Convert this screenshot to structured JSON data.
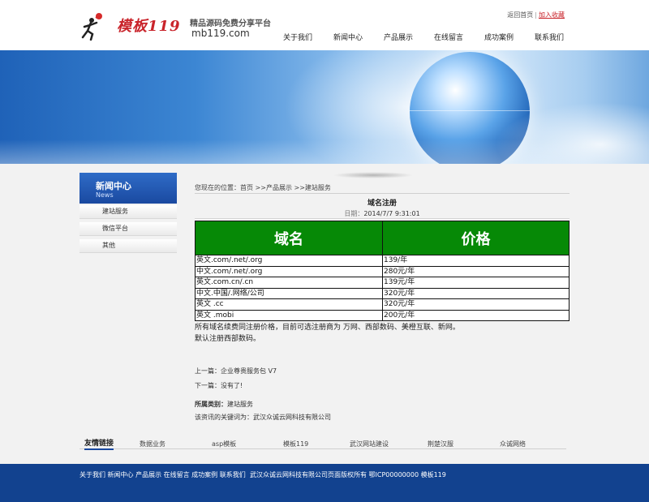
{
  "header": {
    "brand": "模板119",
    "slogan": "精品源码免费分享平台",
    "site": "mb119.com",
    "top_links": {
      "home": "返回首页",
      "separator": "|",
      "favorite": "加入收藏"
    },
    "nav": [
      "关于我们",
      "新闻中心",
      "产品展示",
      "在线留言",
      "成功案例",
      "联系我们"
    ]
  },
  "sidebar": {
    "title": "新闻中心",
    "subtitle": "News",
    "items": [
      "建站服务",
      "微信平台",
      "其他"
    ]
  },
  "breadcrumb": "您现在的位置：首页 >>产品展示 >>建站服务",
  "article": {
    "title": "域名注册",
    "date_label": "日期：",
    "date_value": "2014/7/7 9:31:01",
    "table": {
      "headers": [
        "域名",
        "价格"
      ],
      "rows": [
        [
          "英文.com/.net/.org",
          "139/年"
        ],
        [
          "中文.com/.net/.org",
          "280元/年"
        ],
        [
          "英文.com.cn/.cn",
          "139元/年"
        ],
        [
          "中文.中国/.网络/公司",
          "320元/年"
        ],
        [
          "英文 .cc",
          "320元/年"
        ],
        [
          "英文 .mobi",
          "200元/年"
        ]
      ]
    },
    "desc_line1": "所有域名续费同注册价格，目前可选注册商为 万网、西部数码、美橙互联、新网。",
    "desc_line2": "默认注册西部数码。",
    "prev_label": "上一篇：",
    "prev_value": "企业尊贵服务包 V7",
    "next_label": "下一篇：",
    "next_value": "没有了!",
    "category_label": "所属类别：",
    "category_value": "建站服务",
    "keywords": "该资讯的关键词为：武汉众诚云网科技有限公司"
  },
  "friends": {
    "title": "友情链接",
    "links": [
      "数据业务",
      "asp模板",
      "模板119",
      "武汉网站建设",
      "荆楚汉服",
      "众诚网络"
    ]
  },
  "footer": {
    "links": "关于我们 新闻中心 产品展示 在线留言 成功案例 联系我们",
    "copyright": "武汉众诚云网科技有限公司页面版权所有  鄂ICP00000000  模板119"
  }
}
